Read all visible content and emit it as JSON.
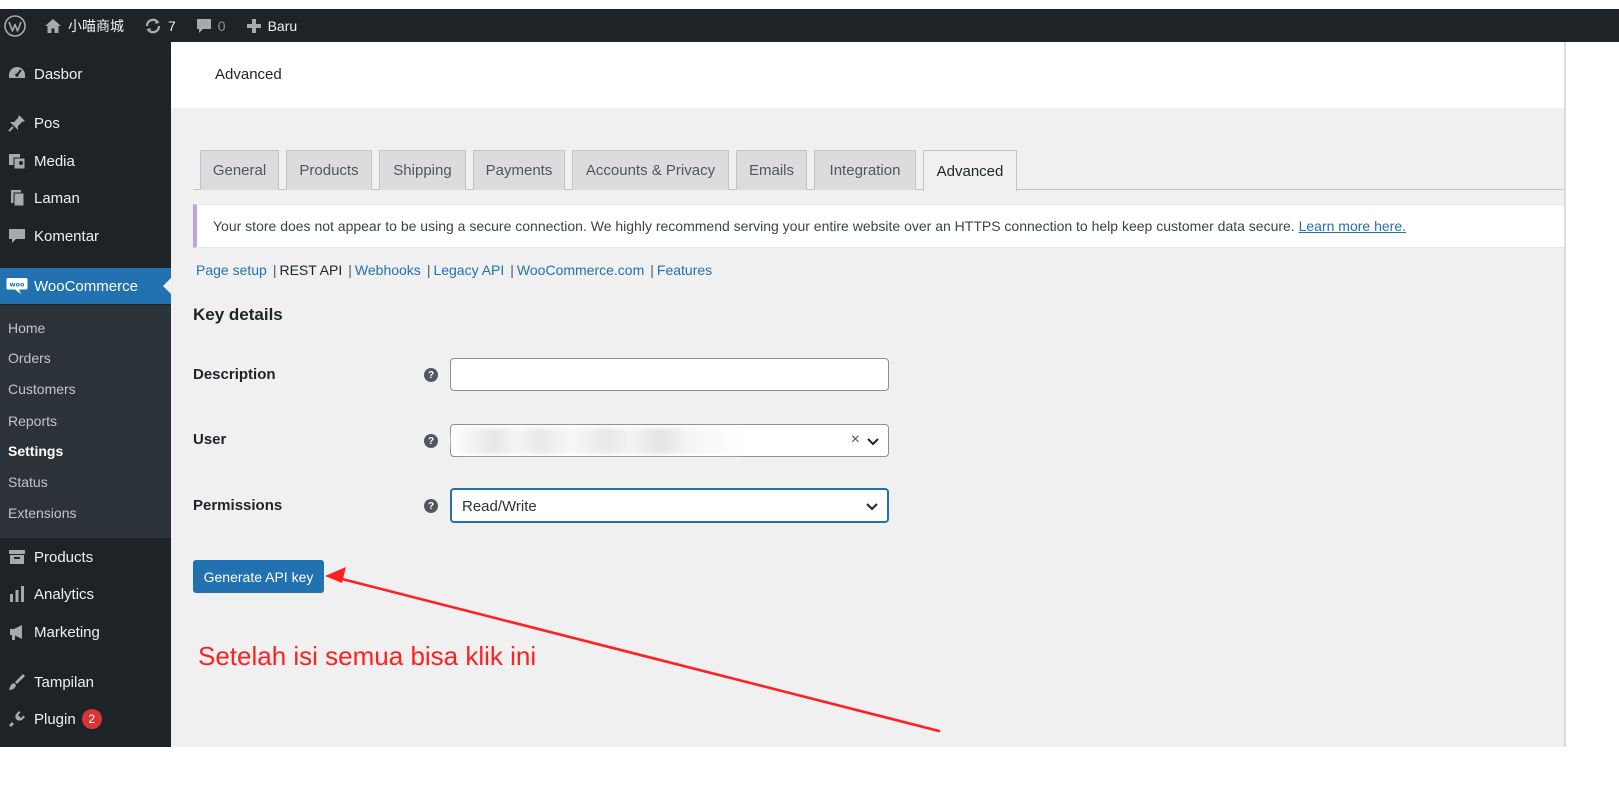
{
  "adminbar": {
    "site_name": "小喵商城",
    "updates_count": "7",
    "comments_count": "0",
    "new_label": "Baru"
  },
  "sidebar": {
    "items": [
      {
        "label": "Dasbor",
        "icon": "dashboard-icon"
      },
      {
        "label": "Pos",
        "icon": "pin-icon"
      },
      {
        "label": "Media",
        "icon": "media-icon"
      },
      {
        "label": "Laman",
        "icon": "page-icon"
      },
      {
        "label": "Komentar",
        "icon": "comment-icon"
      },
      {
        "label": "WooCommerce",
        "icon": "woo-icon"
      },
      {
        "label": "Products",
        "icon": "archive-icon"
      },
      {
        "label": "Analytics",
        "icon": "bar-chart-icon"
      },
      {
        "label": "Marketing",
        "icon": "megaphone-icon"
      },
      {
        "label": "Tampilan",
        "icon": "brush-icon"
      },
      {
        "label": "Plugin",
        "icon": "plugin-icon",
        "badge": "2"
      }
    ],
    "submenu": [
      "Home",
      "Orders",
      "Customers",
      "Reports",
      "Settings",
      "Status",
      "Extensions"
    ]
  },
  "header": {
    "title": "Advanced"
  },
  "tabs": [
    "General",
    "Products",
    "Shipping",
    "Payments",
    "Accounts & Privacy",
    "Emails",
    "Integration",
    "Advanced"
  ],
  "notice": {
    "text": "Your store does not appear to be using a secure connection. We highly recommend serving your entire website over an HTTPS connection to help keep customer data secure.",
    "link": "Learn more here."
  },
  "sections": {
    "page_setup": "Page setup",
    "rest_api": "REST API",
    "webhooks": "Webhooks",
    "legacy_api": "Legacy API",
    "woocommerce_com": "WooCommerce.com",
    "features": "Features",
    "sep": "|"
  },
  "form": {
    "title": "Key details",
    "description_label": "Description",
    "description_value": "",
    "user_label": "User",
    "permissions_label": "Permissions",
    "permissions_value": "Read/Write",
    "help_glyph": "?",
    "clear_glyph": "×",
    "submit_label": "Generate API key"
  },
  "annotation": {
    "text": "Setelah isi semua bisa klik ini",
    "color": "#ff2020"
  },
  "colors": {
    "accent": "#2271b1",
    "sidebar": "#1d2327",
    "badge": "#d63638"
  }
}
